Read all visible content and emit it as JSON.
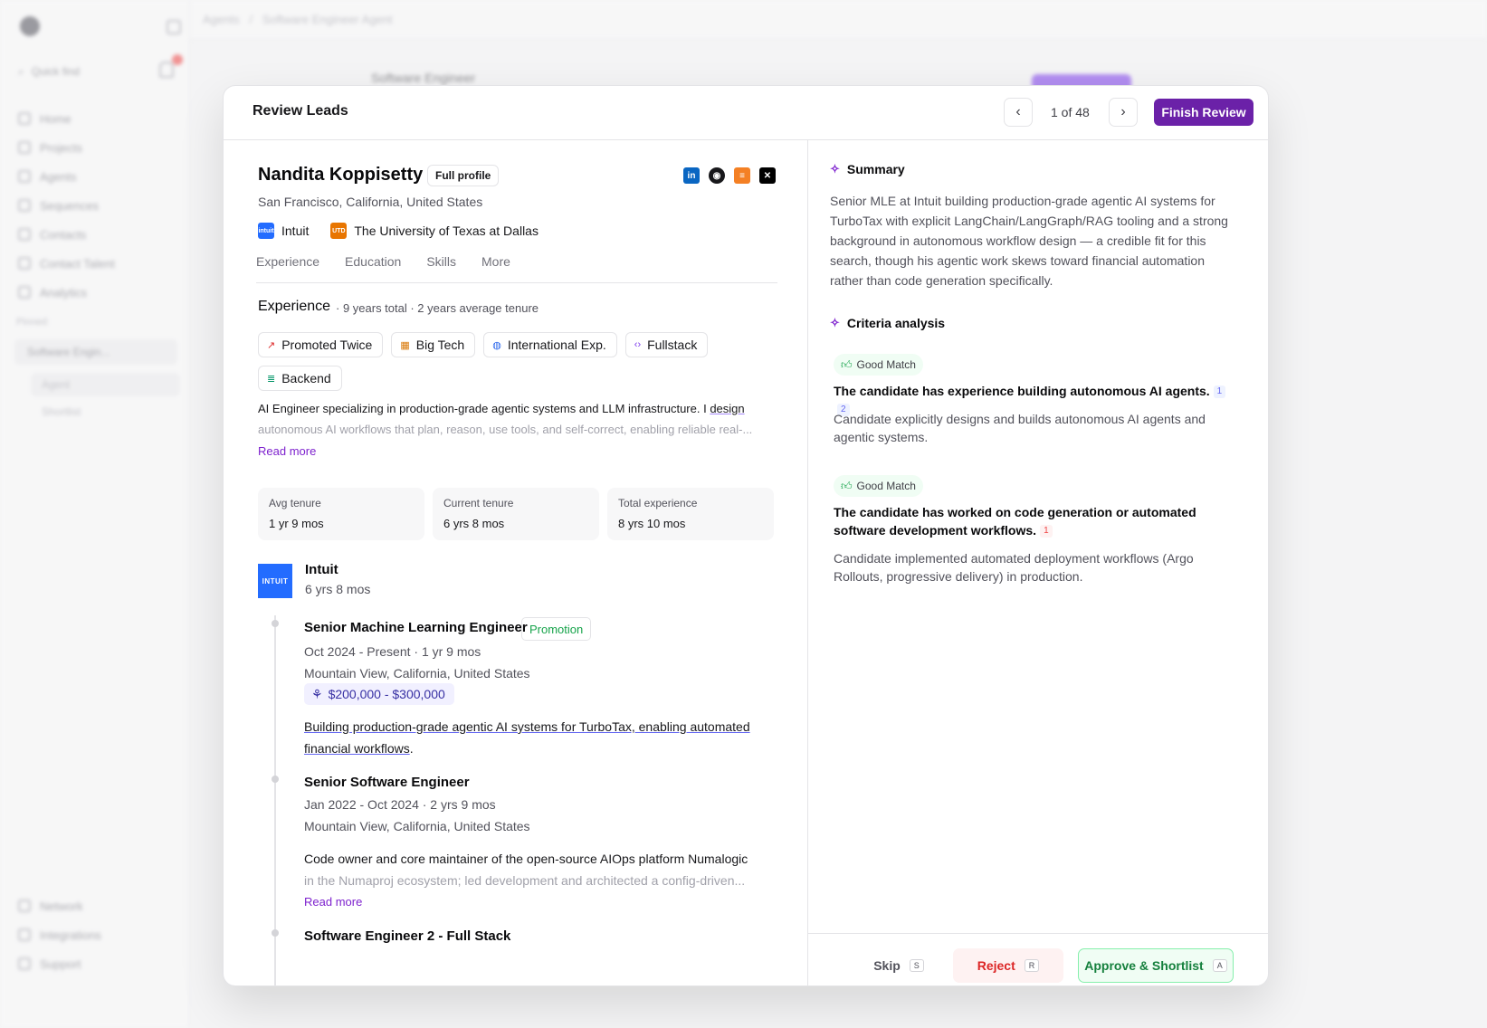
{
  "background": {
    "breadcrumb": [
      "Agents",
      "Software Engineer Agent"
    ],
    "search_placeholder": "Quick find",
    "nav": [
      "Home",
      "Projects",
      "Agents",
      "Sequences",
      "Contacts",
      "Contact Talent",
      "Analytics"
    ],
    "section_label": "Pinned",
    "agent_item": "Software Engin...",
    "sub_items": [
      "Agent",
      "Shortlist"
    ],
    "bottom_nav": [
      "Network",
      "Integrations",
      "Support"
    ],
    "main_title": "Software Engineer"
  },
  "modal": {
    "title": "Review Leads",
    "counter": "1 of 48",
    "finish_label": "Finish Review"
  },
  "candidate": {
    "name": "Nandita Koppisetty",
    "full_profile_label": "Full profile",
    "location": "San Francisco, California, United States",
    "orgs": [
      {
        "name": "Intuit",
        "logo_text": "intuit",
        "color": "#236cff"
      },
      {
        "name": "The University of Texas at Dallas",
        "logo_text": "UTD",
        "color": "#e87500"
      }
    ],
    "socials": [
      "linkedin-icon",
      "github-icon",
      "stackoverflow-icon",
      "x-icon"
    ]
  },
  "tabs": [
    "Experience",
    "Education",
    "Skills",
    "More"
  ],
  "experience": {
    "heading": "Experience",
    "meta": "· 9 years total · 2 years average tenure",
    "badges": [
      {
        "label": "Promoted Twice",
        "icon": "trend-up-icon"
      },
      {
        "label": "Big Tech",
        "icon": "building-icon"
      },
      {
        "label": "International Exp.",
        "icon": "globe-icon"
      },
      {
        "label": "Fullstack",
        "icon": "code-icon"
      },
      {
        "label": "Backend",
        "icon": "server-icon"
      }
    ],
    "summary_start": "AI Engineer specializing in production-grade agentic systems and LLM infrastructure. I ",
    "summary_link": "design",
    "summary_fade": "autonomous AI workflows that plan, reason, use tools, and self-correct, enabling reliable real-...",
    "read_more": "Read more",
    "stats": [
      {
        "label": "Avg tenure",
        "value": "1 yr 9 mos"
      },
      {
        "label": "Current tenure",
        "value": "6 yrs 8 mos"
      },
      {
        "label": "Total experience",
        "value": "8 yrs 10 mos"
      }
    ],
    "company": {
      "name": "Intuit",
      "duration": "6 yrs 8 mos",
      "logo_text": "INTUIT"
    },
    "roles": [
      {
        "title": "Senior Machine Learning Engineer",
        "tag": "Promotion",
        "dates": "Oct 2024 - Present · 1 yr 9 mos",
        "location": "Mountain View, California, United States",
        "salary": "$200,000 - $300,000",
        "desc_link": "Building production-grade agentic AI systems for TurboTax, enabling automated financial workflows",
        "desc_end": "."
      },
      {
        "title": "Senior Software Engineer",
        "dates": "Jan 2022 - Oct 2024 · 2 yrs 9 mos",
        "location": "Mountain View, California, United States",
        "desc": "Code owner and core maintainer of the open-source AIOps platform Numalogic",
        "desc_fade": "in the Numaproj ecosystem; led development and architected a config-driven...",
        "read_more": "Read more"
      },
      {
        "title": "Software Engineer 2 - Full Stack"
      }
    ]
  },
  "right": {
    "summary_title": "Summary",
    "summary_body": "Senior MLE at Intuit building production-grade agentic AI systems for TurboTax with explicit LangChain/LangGraph/RAG tooling and a strong background in autonomous workflow design — a credible fit for this search, though his agentic work skews toward financial automation rather than code generation specifically.",
    "criteria_title": "Criteria analysis",
    "criteria": [
      {
        "match": "Good Match",
        "text": "The candidate has experience building autonomous AI agents.",
        "cites": [
          "1",
          "2"
        ],
        "body": "Candidate explicitly designs and builds autonomous AI agents and agentic systems."
      },
      {
        "match": "Good Match",
        "text": "The candidate has worked on code generation or automated software development workflows.",
        "cites": [
          "1"
        ],
        "body": "Candidate implemented automated deployment workflows (Argo Rollouts, progressive delivery) in production."
      }
    ],
    "footer": {
      "skip": "Skip",
      "skip_key": "S",
      "reject": "Reject",
      "reject_key": "R",
      "approve": "Approve & Shortlist",
      "approve_key": "A"
    }
  }
}
